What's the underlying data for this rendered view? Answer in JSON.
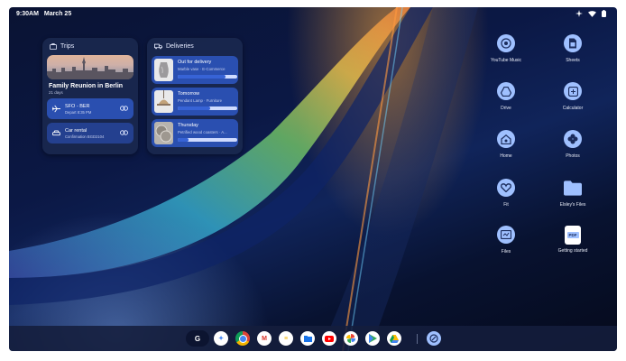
{
  "status_bar": {
    "time": "9:30AM",
    "date": "March 25"
  },
  "trips_widget": {
    "title": "Trips",
    "trip_title": "Family Reunion in Berlin",
    "trip_subtitle": "21 days",
    "rows": [
      {
        "title": "SFO - BER",
        "subtitle": "Depart 8:35 PM",
        "icon": "airplane-icon"
      },
      {
        "title": "Car rental",
        "subtitle": "Confirmation BGD2104",
        "icon": "car-icon"
      }
    ]
  },
  "deliveries_widget": {
    "title": "Deliveries",
    "items": [
      {
        "title": "Out for delivery",
        "subtitle": "Marble vase · E-Commerce",
        "progress": 0.8
      },
      {
        "title": "Tomorrow",
        "subtitle": "Pendant Lamp · Furniture",
        "progress": 0.55
      },
      {
        "title": "Thursday",
        "subtitle": "Petrified wood coasters · A...",
        "progress": 0.18
      }
    ]
  },
  "apps": [
    {
      "label": "YouTube Music",
      "icon": "youtube-music-icon"
    },
    {
      "label": "Sheets",
      "icon": "sheets-icon"
    },
    {
      "label": "Drive",
      "icon": "drive-icon"
    },
    {
      "label": "Calculator",
      "icon": "calculator-icon"
    },
    {
      "label": "Home",
      "icon": "home-icon"
    },
    {
      "label": "Photos",
      "icon": "photos-icon"
    },
    {
      "label": "Fit",
      "icon": "fit-icon"
    },
    {
      "label": "Elsley's Files",
      "icon": "folder-icon"
    },
    {
      "label": "Files",
      "icon": "files-icon"
    },
    {
      "label": "Getting started",
      "icon": "pdf-icon",
      "badge": "PDF"
    }
  ],
  "taskbar": {
    "google_label": "G",
    "items": [
      {
        "name": "assistant-icon",
        "glyph": "✦",
        "bg": "#ffffff",
        "fg": "#4285f4"
      },
      {
        "name": "chrome-icon",
        "glyph": "",
        "bg": "#ffffff",
        "fg": "#db4437"
      },
      {
        "name": "gmail-icon",
        "glyph": "M",
        "bg": "#ffffff",
        "fg": "#d93025"
      },
      {
        "name": "docs-icon",
        "glyph": "≡",
        "bg": "#ffffff",
        "fg": "#f4b400"
      },
      {
        "name": "files-app-icon",
        "glyph": "",
        "bg": "#ffffff",
        "fg": "#1a73e8"
      },
      {
        "name": "youtube-icon",
        "glyph": "▶",
        "bg": "#ffffff",
        "fg": "#ff0000"
      },
      {
        "name": "photos-app-icon",
        "glyph": "✿",
        "bg": "#ffffff",
        "fg": "#ea4335"
      },
      {
        "name": "play-store-icon",
        "glyph": "▶",
        "bg": "#ffffff",
        "fg": "#34a853"
      },
      {
        "name": "drive-app-icon",
        "glyph": "▲",
        "bg": "#ffffff",
        "fg": "#fbbc04"
      }
    ],
    "launcher_icon": "launcher-icon"
  },
  "colors": {
    "widget_bg": "#1a284e",
    "row_bg": "#2a4fb0",
    "app_icon_bg": "#9fc0ff",
    "progress_fill": "#3763d6"
  }
}
